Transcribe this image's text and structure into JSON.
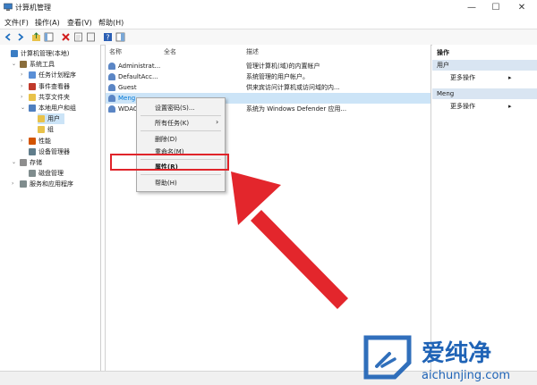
{
  "window": {
    "title": "计算机管理",
    "min": "—",
    "max": "☐",
    "close": "✕"
  },
  "menu": [
    "文件(F)",
    "操作(A)",
    "查看(V)",
    "帮助(H)"
  ],
  "tree": [
    {
      "label": "计算机管理(本地)",
      "indent": 0,
      "exp": "",
      "icon": "computer-icon"
    },
    {
      "label": "系统工具",
      "indent": 1,
      "exp": "⌄",
      "icon": "tools-icon"
    },
    {
      "label": "任务计划程序",
      "indent": 2,
      "exp": "›",
      "icon": "clock-icon"
    },
    {
      "label": "事件查看器",
      "indent": 2,
      "exp": "›",
      "icon": "event-viewer-icon"
    },
    {
      "label": "共享文件夹",
      "indent": 2,
      "exp": "›",
      "icon": "shared-folder-icon"
    },
    {
      "label": "本地用户和组",
      "indent": 2,
      "exp": "⌄",
      "icon": "users-icon"
    },
    {
      "label": "用户",
      "indent": 3,
      "exp": "",
      "icon": "folder-icon",
      "selected": true
    },
    {
      "label": "组",
      "indent": 3,
      "exp": "",
      "icon": "folder-icon"
    },
    {
      "label": "性能",
      "indent": 2,
      "exp": "›",
      "icon": "performance-icon"
    },
    {
      "label": "设备管理器",
      "indent": 2,
      "exp": "",
      "icon": "device-manager-icon"
    },
    {
      "label": "存储",
      "indent": 1,
      "exp": "⌄",
      "icon": "storage-icon"
    },
    {
      "label": "磁盘管理",
      "indent": 2,
      "exp": "",
      "icon": "disk-icon"
    },
    {
      "label": "服务和应用程序",
      "indent": 1,
      "exp": "›",
      "icon": "services-icon"
    }
  ],
  "list": {
    "headers": [
      "名称",
      "全名",
      "描述"
    ],
    "rows": [
      {
        "name": "Administrat...",
        "full": "",
        "desc": "管理计算机(域)的内置帐户"
      },
      {
        "name": "DefaultAcc...",
        "full": "",
        "desc": "系统管理的用户帐户。"
      },
      {
        "name": "Guest",
        "full": "",
        "desc": "供来宾访问计算机或访问域的内..."
      },
      {
        "name": "Meng",
        "full": "",
        "desc": "",
        "selected": true
      },
      {
        "name": "WDAG",
        "full": "",
        "desc": "系统为 Windows Defender 应用..."
      }
    ]
  },
  "context_menu": {
    "items": [
      "设置密码(S)...",
      "所有任务(K)",
      "删除(D)",
      "重命名(M)",
      "属性(R)",
      "帮助(H)"
    ],
    "submenu_arrow": "›"
  },
  "actions": {
    "header": "操作",
    "sections": [
      {
        "title": "用户",
        "more": "更多操作",
        "arrow": "▸"
      },
      {
        "title": "Meng",
        "more": "更多操作",
        "arrow": "▸"
      }
    ]
  },
  "watermark": {
    "brand": "爱纯净",
    "url": "aichunjing.com"
  },
  "colors": {
    "highlight": "#e0242a",
    "selection": "#cce4f7",
    "section": "#d9e5f2",
    "meng_row": "#0078d7"
  }
}
